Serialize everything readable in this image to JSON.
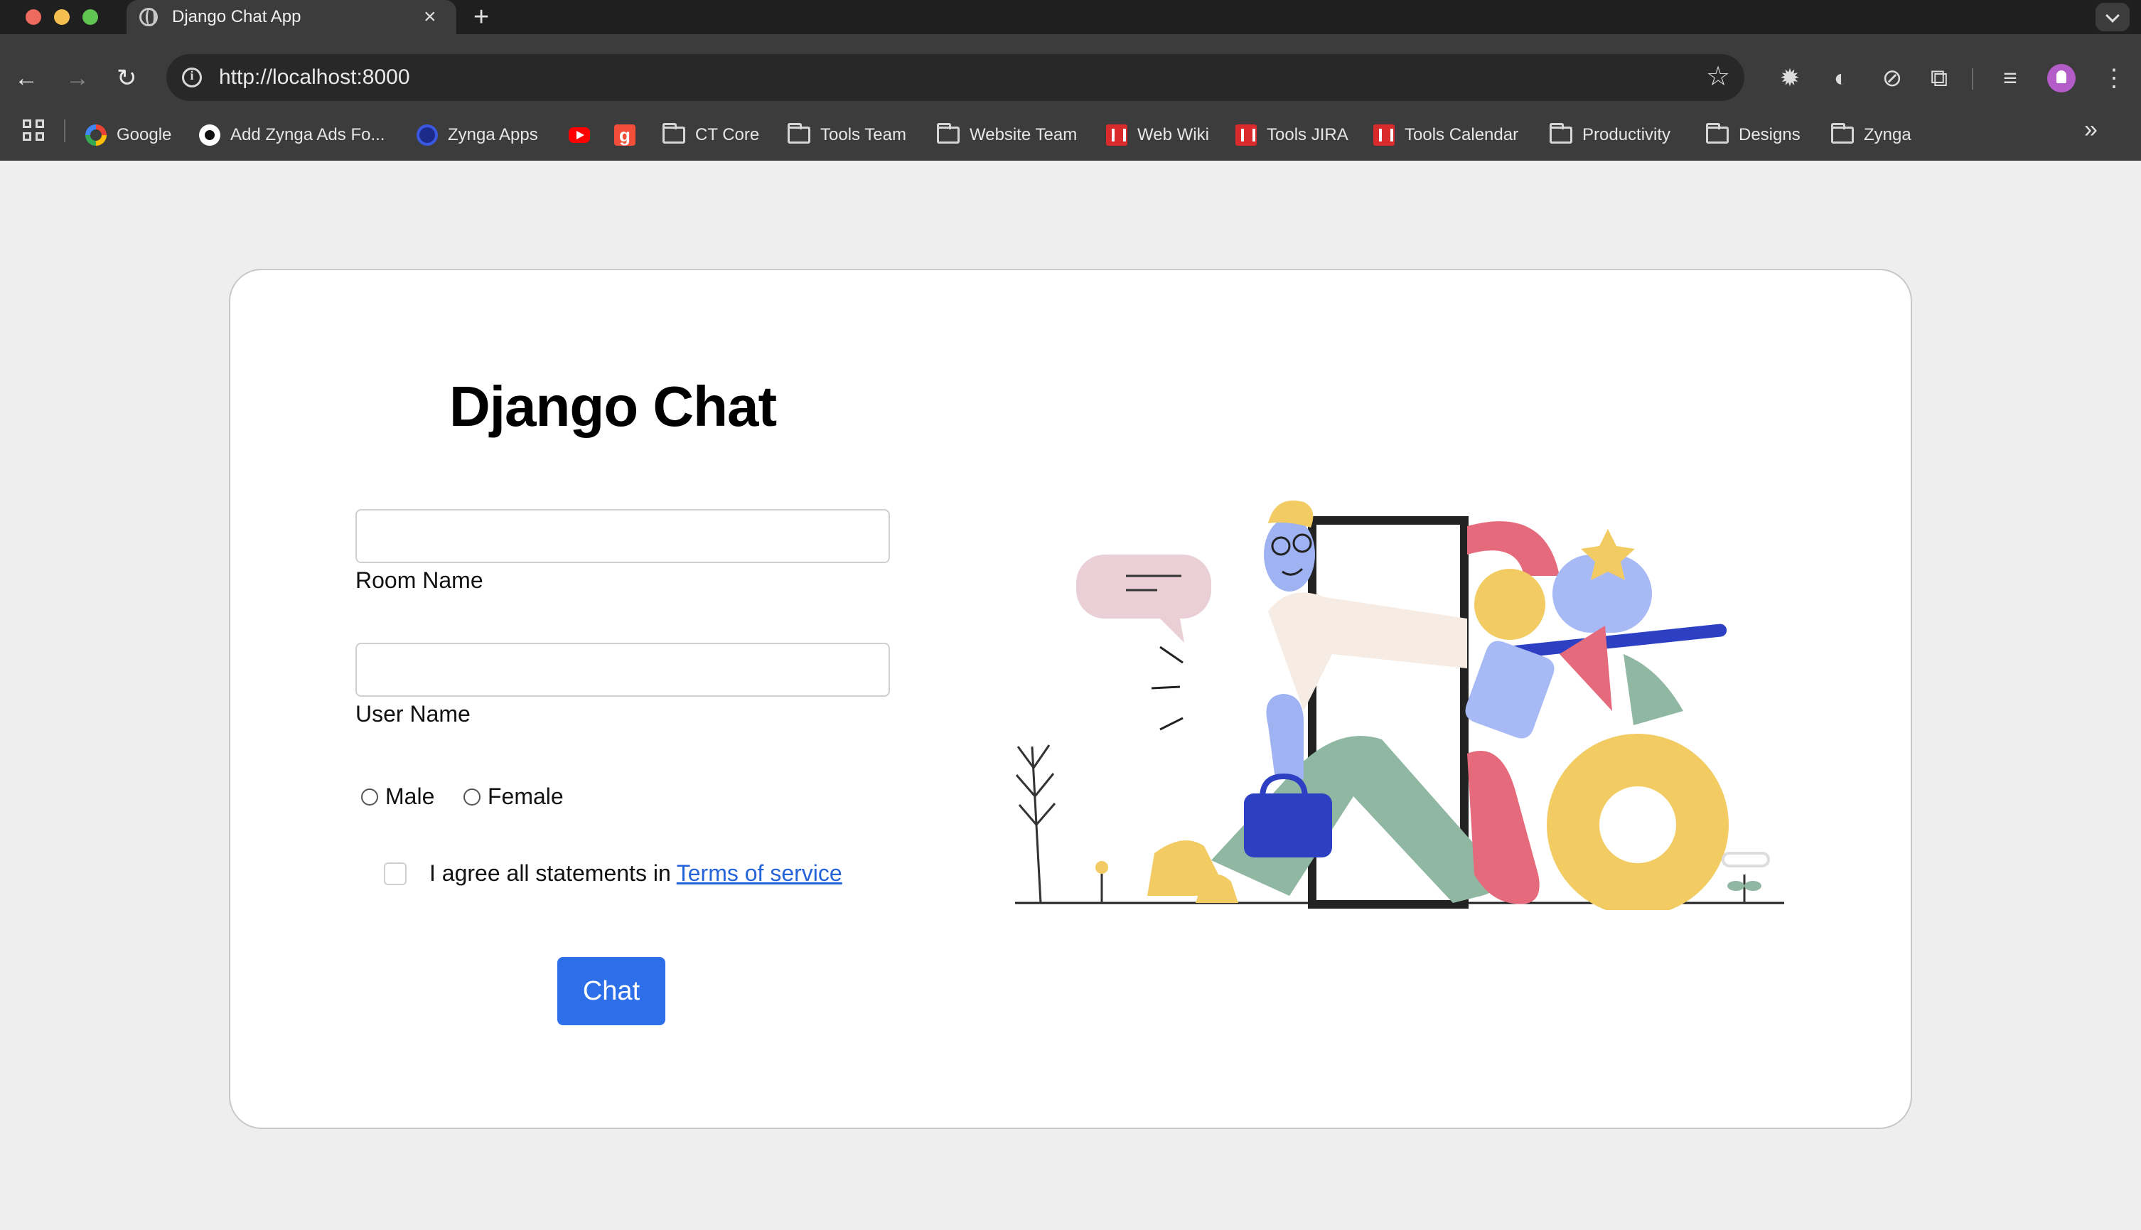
{
  "browser": {
    "tab_title": "Django Chat App",
    "tab_close": "×",
    "new_tab": "+",
    "url": "http://localhost:8000",
    "bookmarks": [
      {
        "label": "Google",
        "icon": "google-logo-icon"
      },
      {
        "label": "Add Zynga Ads Fo...",
        "icon": "github-logo-icon"
      },
      {
        "label": "Zynga Apps",
        "icon": "zynga-logo-icon"
      },
      {
        "label": "",
        "icon": "youtube-logo-icon"
      },
      {
        "label": "g",
        "icon": "g-logo-icon"
      },
      {
        "label": "CT Core",
        "icon": "folder-icon"
      },
      {
        "label": "Tools Team",
        "icon": "folder-icon"
      },
      {
        "label": "Website Team",
        "icon": "folder-icon"
      },
      {
        "label": "Web Wiki",
        "icon": "red-app-icon"
      },
      {
        "label": "Tools JIRA",
        "icon": "red-app-icon"
      },
      {
        "label": "Tools Calendar",
        "icon": "red-app-icon"
      },
      {
        "label": "Productivity",
        "icon": "folder-icon"
      },
      {
        "label": "Designs",
        "icon": "folder-icon"
      },
      {
        "label": "Zynga",
        "icon": "folder-icon"
      }
    ]
  },
  "page": {
    "title": "Django Chat",
    "room_name": {
      "label": "Room Name",
      "value": ""
    },
    "user_name": {
      "label": "User Name",
      "value": ""
    },
    "gender_options": [
      "Male",
      "Female"
    ],
    "agree_text": "I agree all statements in",
    "terms_link": "Terms of service",
    "submit_label": "Chat"
  },
  "colors": {
    "accent": "#2c6fe8",
    "link": "#2563d9",
    "page_bg": "#eeeeee"
  }
}
